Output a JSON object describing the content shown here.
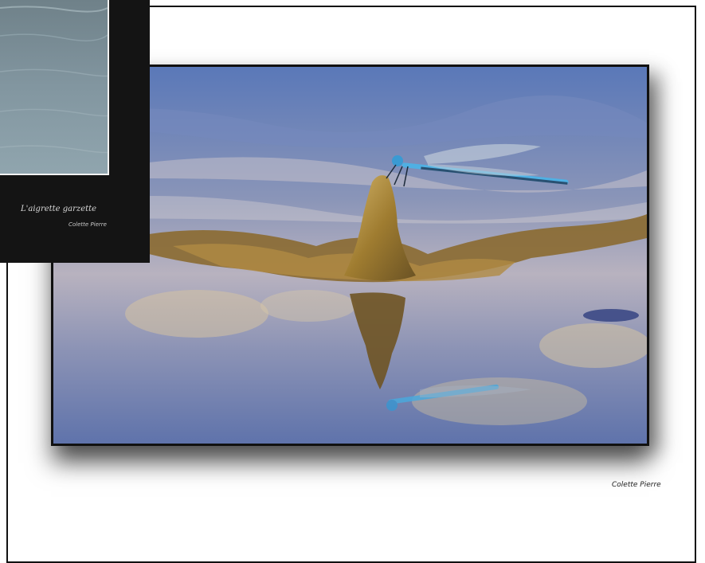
{
  "main": {
    "credit": "Colette Pierre",
    "photo_subject": "blue damselfly perched on a rock in water with reflection"
  },
  "thumbnail": {
    "title": "L'aigrette garzette",
    "credit": "Colette Pierre"
  },
  "colors": {
    "water_blue": "#6e86b8",
    "water_light": "#c9c3cf",
    "rock_ochre": "#a8863a",
    "damselfly_blue": "#5fb6e6",
    "panel_dark": "#141414"
  }
}
